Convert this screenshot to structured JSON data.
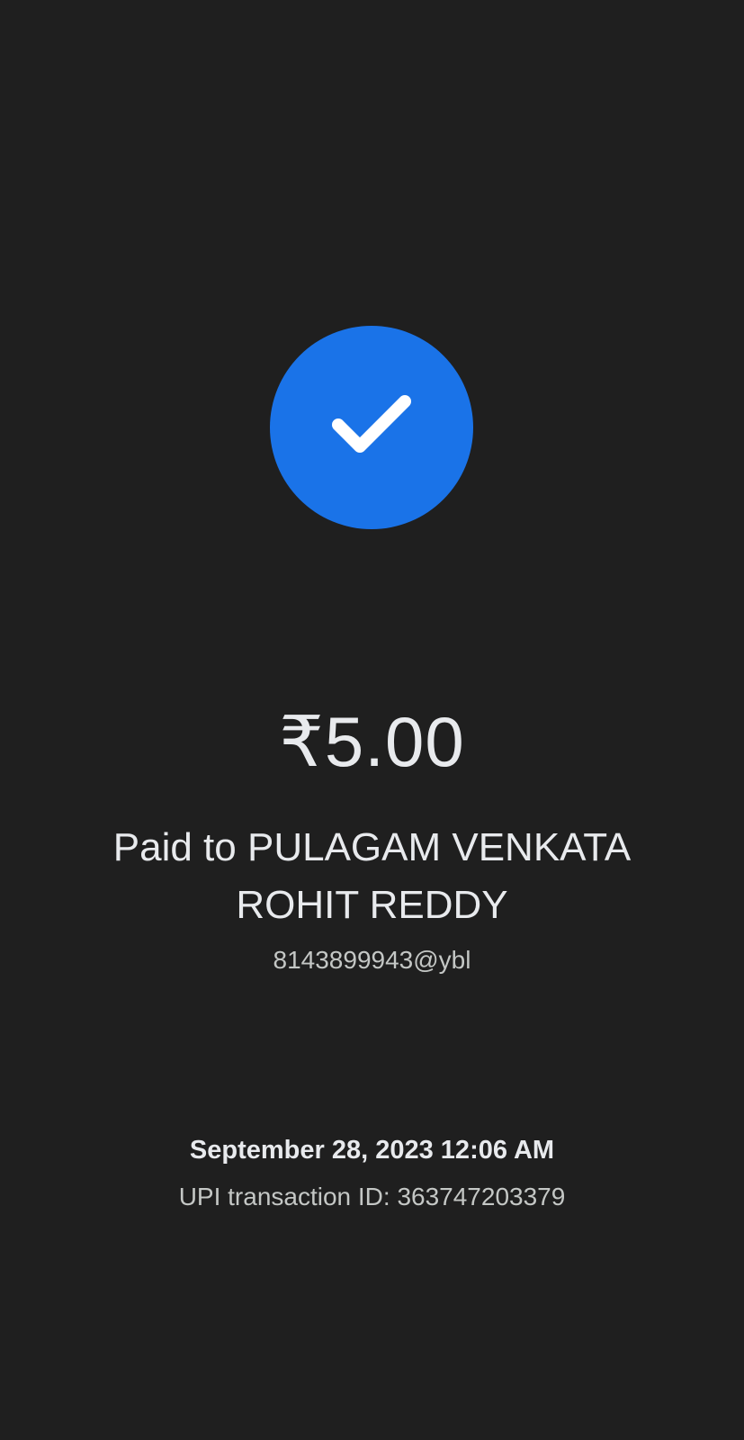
{
  "payment": {
    "amount": "₹5.00",
    "payee_line": "Paid to PULAGAM VENKATA ROHIT REDDY",
    "upi_id": "8143899943@ybl",
    "datetime": "September 28, 2023 12:06 AM",
    "transaction_id": "UPI transaction ID: 363747203379"
  },
  "status_icon": {
    "name": "checkmark-icon",
    "circle_color": "#1a73e8",
    "check_color": "#ffffff"
  }
}
